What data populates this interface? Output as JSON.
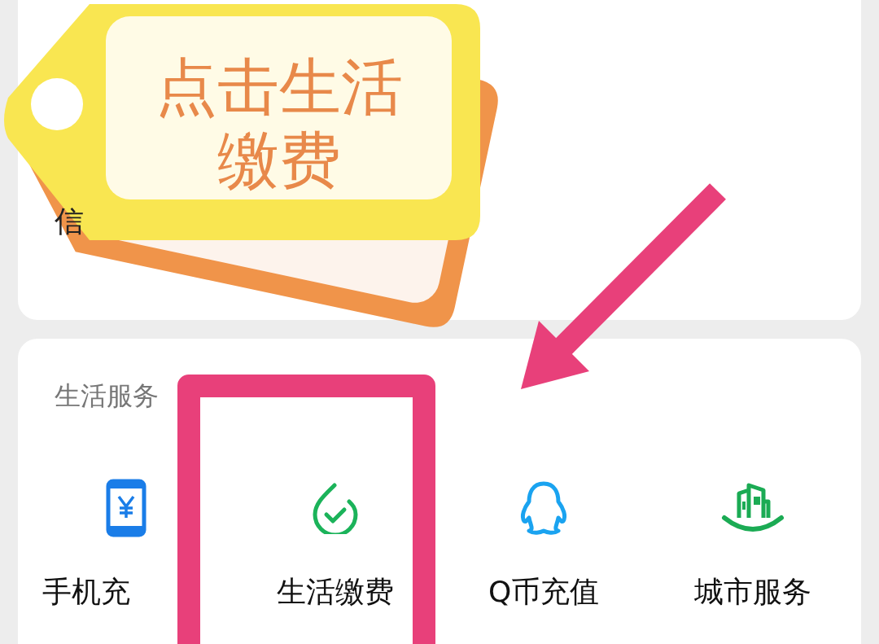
{
  "top_card": {
    "label": "信"
  },
  "callout": {
    "lines": [
      "点击生活",
      "缴费"
    ]
  },
  "life_services": {
    "title": "生活服务",
    "items": [
      {
        "kind": "phone",
        "label": "手机充"
      },
      {
        "kind": "check",
        "label": "生活缴费"
      },
      {
        "kind": "penguin",
        "label": "Q币充值"
      },
      {
        "kind": "city",
        "label": "城市服务"
      }
    ]
  }
}
